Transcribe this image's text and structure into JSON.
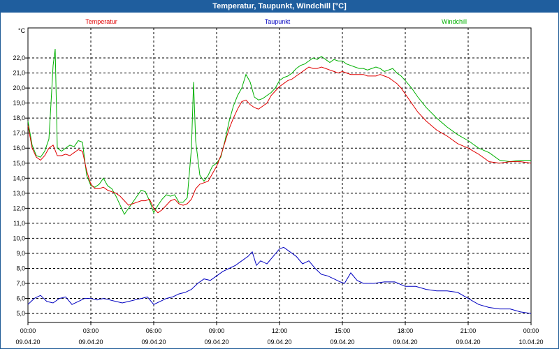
{
  "window": {
    "title": "Temperatur, Taupunkt, Windchill [°C]"
  },
  "colors": {
    "title_bar": "#1f5e9e",
    "temperature": "#e00000",
    "dewpoint": "#0000c0",
    "windchill": "#00b000",
    "grid": "#000000"
  },
  "chart_data": {
    "type": "line",
    "title": "Temperatur, Taupunkt, Windchill [°C]",
    "ylabel": "°C",
    "xlabel": "",
    "ylim": [
      4.4,
      24.0
    ],
    "xlim": [
      0,
      24
    ],
    "grid": true,
    "legend_position": "top",
    "y_ticks": [
      "5,0",
      "6,0",
      "7,0",
      "8,0",
      "9,0",
      "10,0",
      "11,0",
      "12,0",
      "13,0",
      "14,0",
      "15,0",
      "16,0",
      "17,0",
      "18,0",
      "19,0",
      "20,0",
      "21,0",
      "22,0"
    ],
    "x_ticks": [
      {
        "time": "00:00",
        "date": "09.04.20"
      },
      {
        "time": "03:00",
        "date": "09.04.20"
      },
      {
        "time": "06:00",
        "date": "09.04.20"
      },
      {
        "time": "09:00",
        "date": "09.04.20"
      },
      {
        "time": "12:00",
        "date": "09.04.20"
      },
      {
        "time": "15:00",
        "date": "09.04.20"
      },
      {
        "time": "18:00",
        "date": "09.04.20"
      },
      {
        "time": "21:00",
        "date": "09.04.20"
      },
      {
        "time": "00:00",
        "date": "10.04.20"
      }
    ],
    "series": [
      {
        "name": "Temperatur",
        "color": "#e00000",
        "x": [
          0,
          0.2,
          0.4,
          0.6,
          0.8,
          1.0,
          1.2,
          1.4,
          1.6,
          1.8,
          2.0,
          2.2,
          2.4,
          2.6,
          2.8,
          3.0,
          3.2,
          3.4,
          3.6,
          3.8,
          4.0,
          4.2,
          4.4,
          4.6,
          4.8,
          5.0,
          5.2,
          5.4,
          5.6,
          5.8,
          6.0,
          6.2,
          6.4,
          6.6,
          6.8,
          7.0,
          7.2,
          7.4,
          7.6,
          7.8,
          8.0,
          8.2,
          8.4,
          8.6,
          8.8,
          9.0,
          9.2,
          9.4,
          9.6,
          9.8,
          10.0,
          10.2,
          10.4,
          10.6,
          10.8,
          11.0,
          11.2,
          11.4,
          11.6,
          11.8,
          12.0,
          12.2,
          12.4,
          12.6,
          12.8,
          13.0,
          13.2,
          13.4,
          13.6,
          13.8,
          14.0,
          14.2,
          14.4,
          14.6,
          14.8,
          15.0,
          15.2,
          15.4,
          15.6,
          15.8,
          16.0,
          16.2,
          16.4,
          16.6,
          16.8,
          17.0,
          17.2,
          17.4,
          17.6,
          17.8,
          18.0,
          18.3,
          18.6,
          19.0,
          19.5,
          20.0,
          20.5,
          21.0,
          21.5,
          22.0,
          22.5,
          23.0,
          23.5,
          24.0
        ],
        "values": [
          17.5,
          16.0,
          15.4,
          15.2,
          15.5,
          16.0,
          16.2,
          15.5,
          15.5,
          15.6,
          15.5,
          15.7,
          15.9,
          15.8,
          14.5,
          13.6,
          13.3,
          13.3,
          13.4,
          13.2,
          13.1,
          13.0,
          12.8,
          12.5,
          12.2,
          12.3,
          12.4,
          12.5,
          12.5,
          12.6,
          12.0,
          11.7,
          11.9,
          12.2,
          12.5,
          12.6,
          12.3,
          12.2,
          12.3,
          12.6,
          13.3,
          13.6,
          13.7,
          13.8,
          14.3,
          14.8,
          15.5,
          16.4,
          17.3,
          18.0,
          18.6,
          19.1,
          19.2,
          18.9,
          18.7,
          18.6,
          18.8,
          19.0,
          19.5,
          19.8,
          20.1,
          20.3,
          20.5,
          20.6,
          20.8,
          21.0,
          21.2,
          21.4,
          21.3,
          21.3,
          21.4,
          21.3,
          21.2,
          21.1,
          21.0,
          21.1,
          21.0,
          20.9,
          20.9,
          20.9,
          20.9,
          20.8,
          20.8,
          20.8,
          20.9,
          20.8,
          20.7,
          20.5,
          20.3,
          20.0,
          19.6,
          19.0,
          18.4,
          17.8,
          17.2,
          16.8,
          16.3,
          16.0,
          15.6,
          15.1,
          15.0,
          15.1,
          15.1,
          15.0
        ]
      },
      {
        "name": "Taupunkt",
        "color": "#0000c0",
        "x": [
          0,
          0.3,
          0.6,
          0.9,
          1.2,
          1.5,
          1.8,
          2.1,
          2.4,
          2.7,
          3.0,
          3.3,
          3.6,
          3.9,
          4.2,
          4.5,
          4.8,
          5.1,
          5.4,
          5.7,
          6.0,
          6.3,
          6.6,
          6.9,
          7.2,
          7.5,
          7.8,
          8.1,
          8.4,
          8.7,
          9.0,
          9.3,
          9.6,
          9.9,
          10.2,
          10.5,
          10.7,
          10.9,
          11.1,
          11.4,
          11.7,
          12.0,
          12.2,
          12.5,
          12.8,
          13.1,
          13.4,
          13.7,
          14.0,
          14.3,
          14.6,
          14.9,
          15.1,
          15.4,
          15.7,
          16.0,
          16.5,
          17.0,
          17.5,
          18.0,
          18.5,
          19.0,
          19.5,
          20.0,
          20.5,
          21.0,
          21.5,
          22.0,
          22.5,
          23.0,
          23.5,
          24.0
        ],
        "values": [
          5.6,
          6.0,
          6.2,
          5.8,
          5.7,
          6.0,
          6.1,
          5.6,
          5.8,
          6.0,
          6.0,
          5.9,
          6.0,
          5.9,
          5.8,
          5.7,
          5.8,
          5.9,
          6.0,
          6.1,
          5.6,
          5.8,
          6.0,
          6.1,
          6.3,
          6.4,
          6.6,
          7.0,
          7.3,
          7.2,
          7.5,
          7.8,
          8.0,
          8.2,
          8.5,
          8.8,
          9.1,
          8.2,
          8.5,
          8.3,
          8.8,
          9.3,
          9.4,
          9.1,
          8.8,
          8.3,
          8.5,
          8.0,
          7.6,
          7.5,
          7.3,
          7.1,
          7.0,
          7.7,
          7.2,
          7.0,
          7.0,
          7.1,
          7.1,
          6.8,
          6.8,
          6.6,
          6.5,
          6.5,
          6.4,
          6.0,
          5.6,
          5.4,
          5.3,
          5.3,
          5.1,
          5.0
        ]
      },
      {
        "name": "Windchill",
        "color": "#00b000",
        "x": [
          0,
          0.2,
          0.4,
          0.6,
          0.8,
          1.0,
          1.1,
          1.2,
          1.3,
          1.4,
          1.6,
          1.8,
          2.0,
          2.2,
          2.4,
          2.6,
          2.8,
          3.0,
          3.2,
          3.4,
          3.6,
          3.8,
          4.0,
          4.2,
          4.4,
          4.6,
          4.8,
          5.0,
          5.2,
          5.4,
          5.6,
          5.8,
          6.0,
          6.2,
          6.4,
          6.6,
          6.8,
          7.0,
          7.2,
          7.4,
          7.6,
          7.8,
          7.9,
          8.0,
          8.2,
          8.4,
          8.6,
          8.8,
          9.0,
          9.2,
          9.4,
          9.6,
          9.8,
          10.0,
          10.2,
          10.4,
          10.6,
          10.8,
          11.0,
          11.2,
          11.4,
          11.6,
          11.8,
          12.0,
          12.2,
          12.4,
          12.6,
          12.8,
          13.0,
          13.2,
          13.4,
          13.6,
          13.8,
          14.0,
          14.2,
          14.4,
          14.6,
          14.8,
          15.0,
          15.2,
          15.4,
          15.6,
          15.8,
          16.0,
          16.2,
          16.4,
          16.6,
          16.8,
          17.0,
          17.2,
          17.4,
          17.6,
          17.8,
          18.0,
          18.3,
          18.6,
          19.0,
          19.5,
          20.0,
          20.5,
          21.0,
          21.5,
          22.0,
          22.5,
          23.0,
          23.5,
          24.0
        ],
        "values": [
          17.8,
          16.2,
          15.5,
          15.4,
          15.8,
          16.6,
          19.0,
          21.5,
          22.6,
          16.0,
          15.8,
          16.0,
          16.2,
          16.1,
          16.5,
          16.4,
          14.2,
          13.5,
          13.4,
          13.6,
          14.0,
          13.5,
          13.3,
          12.8,
          12.2,
          11.6,
          12.0,
          12.4,
          12.8,
          13.2,
          13.1,
          12.5,
          11.7,
          12.2,
          12.6,
          12.9,
          12.8,
          12.9,
          12.4,
          12.4,
          12.7,
          16.0,
          20.4,
          16.5,
          14.2,
          13.8,
          14.2,
          14.8,
          15.0,
          15.4,
          16.5,
          17.8,
          18.8,
          19.5,
          20.0,
          20.9,
          20.4,
          19.4,
          19.2,
          19.3,
          19.5,
          19.7,
          20.0,
          20.5,
          20.7,
          20.8,
          21.0,
          21.3,
          21.5,
          21.6,
          21.8,
          22.0,
          21.9,
          22.1,
          21.9,
          21.7,
          21.9,
          21.8,
          21.8,
          21.6,
          21.5,
          21.4,
          21.3,
          21.3,
          21.2,
          21.3,
          21.4,
          21.3,
          21.1,
          21.2,
          21.3,
          21.0,
          20.8,
          20.5,
          20.0,
          19.4,
          18.7,
          18.0,
          17.4,
          16.9,
          16.5,
          16.0,
          15.7,
          15.2,
          15.1,
          15.2,
          15.2
        ]
      }
    ]
  }
}
